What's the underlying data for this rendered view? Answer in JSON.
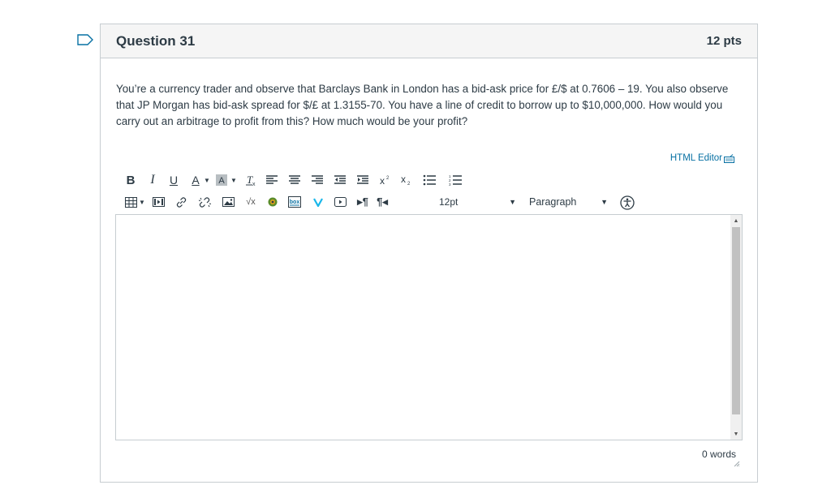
{
  "question": {
    "title": "Question 31",
    "points": "12 pts",
    "text": "You’re a currency trader and observe that Barclays Bank in London has a bid-ask price for £/$ at 0.7606 – 19.  You also observe that JP Morgan has bid-ask spread for $/£ at 1.3155-70. You have a line of credit to borrow up to $10,000,000. How would you carry out an arbitrage to profit from this? How much would be your profit?"
  },
  "editor": {
    "html_editor_label": "HTML Editor",
    "font_size": "12pt",
    "block_format": "Paragraph",
    "toolbar_row1": [
      "bold-icon",
      "italic-icon",
      "underline-icon",
      "text-color-icon",
      "background-color-icon",
      "clear-formatting-icon",
      "align-left-icon",
      "align-center-icon",
      "align-right-icon",
      "outdent-icon",
      "indent-icon",
      "superscript-icon",
      "subscript-icon",
      "bullet-list-icon",
      "numbered-list-icon"
    ],
    "toolbar_row2": [
      "table-icon",
      "media-icon",
      "link-icon",
      "unlink-icon",
      "image-icon",
      "math-icon",
      "record-icon",
      "box-icon",
      "vimeo-icon",
      "embed-icon",
      "ltr-icon",
      "rtl-icon"
    ],
    "word_count": "0 words"
  },
  "colors": {
    "link": "#0770a3",
    "text": "#2d3b45",
    "border": "#c7cdd1",
    "header_bg": "#f5f5f5"
  }
}
